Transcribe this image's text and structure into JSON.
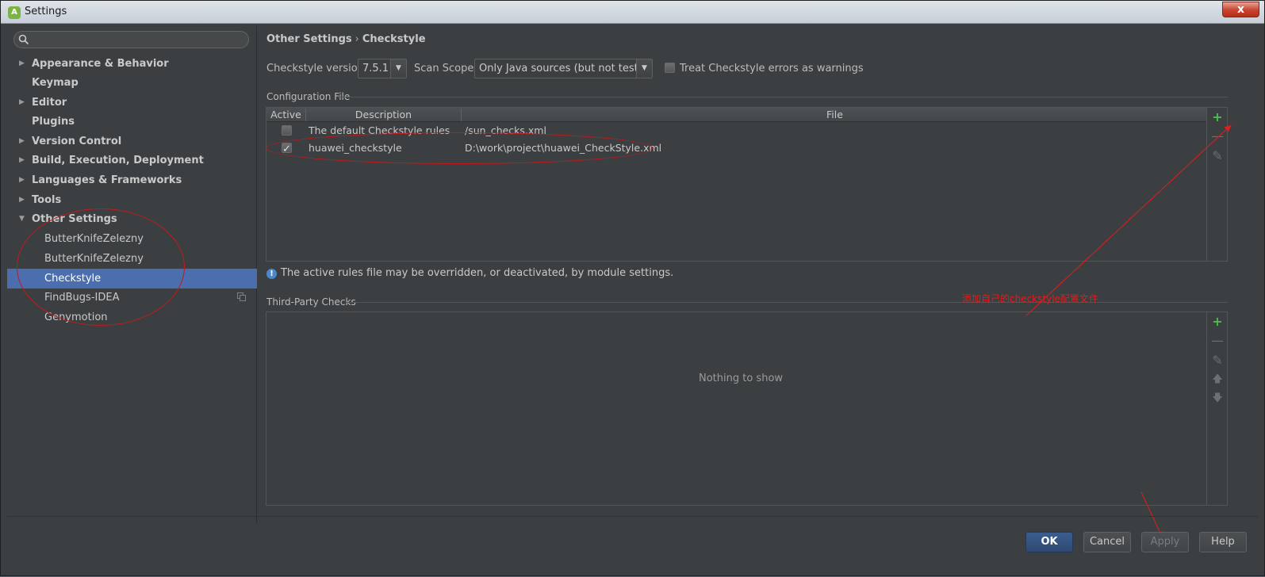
{
  "window": {
    "title": "Settings",
    "close_glyph": "x"
  },
  "search": {
    "placeholder": ""
  },
  "sidebar": {
    "items": [
      {
        "label": "Appearance & Behavior",
        "arrow": "▶"
      },
      {
        "label": "Keymap"
      },
      {
        "label": "Editor",
        "arrow": "▶"
      },
      {
        "label": "Plugins"
      },
      {
        "label": "Version Control",
        "arrow": "▶"
      },
      {
        "label": "Build, Execution, Deployment",
        "arrow": "▶"
      },
      {
        "label": "Languages & Frameworks",
        "arrow": "▶"
      },
      {
        "label": "Tools",
        "arrow": "▶"
      },
      {
        "label": "Other Settings",
        "arrow": "▼"
      }
    ],
    "children": [
      {
        "label": "ButterKnifeZelezny"
      },
      {
        "label": "ButterKnifeZelezny"
      },
      {
        "label": "Checkstyle",
        "selected": true
      },
      {
        "label": "FindBugs-IDEA"
      },
      {
        "label": "Genymotion"
      }
    ]
  },
  "breadcrumb": {
    "parent": "Other Settings",
    "sep": "›",
    "current": "Checkstyle"
  },
  "options": {
    "version_label": "Checkstyle version:",
    "version_value": "7.5.1",
    "scope_label": "Scan Scope:",
    "scope_value": "Only Java sources (but not tests)",
    "treat_label": "Treat Checkstyle errors as warnings",
    "treat_checked": false
  },
  "config": {
    "group_title": "Configuration File",
    "columns": [
      "Active",
      "Description",
      "File"
    ],
    "rows": [
      {
        "active": false,
        "description": "The default Checkstyle rules",
        "file": "/sun_checks.xml"
      },
      {
        "active": true,
        "description": "huawei_checkstyle",
        "file": "D:\\work\\project\\huawei_CheckStyle.xml"
      }
    ]
  },
  "info": {
    "text": "The active rules file may be overridden, or deactivated, by module settings."
  },
  "third_party": {
    "group_title": "Third-Party Checks",
    "empty_text": "Nothing to show"
  },
  "annotation": {
    "text": "添加自己的checkstyle配置文件"
  },
  "icons": {
    "add": "+",
    "remove": "—",
    "edit": "✎",
    "up": "🡅",
    "down": "🡇"
  },
  "buttons": {
    "ok": "OK",
    "cancel": "Cancel",
    "apply": "Apply",
    "help": "Help"
  },
  "colors": {
    "selection": "#4b6eaf",
    "annotation": "#e41b1b",
    "add_icon": "#4fbb4f"
  }
}
